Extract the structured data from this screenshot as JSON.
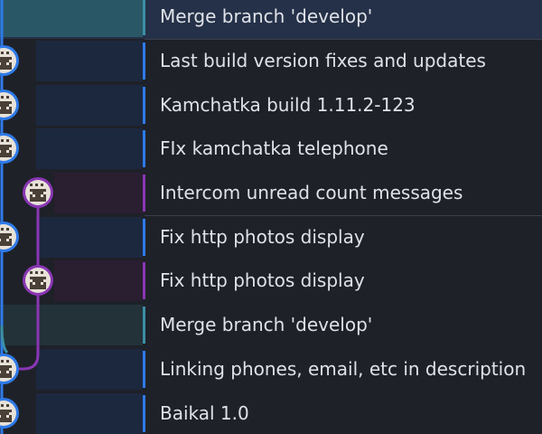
{
  "colors": {
    "background": "#1e2128",
    "selected_row": "#253148",
    "lane_blue": "#2f7ae8",
    "lane_purple": "#8a36b4",
    "lane_teal": "#3b8fa3",
    "text": "#dfe2e8"
  },
  "avatar_icon": "pixel-identicon",
  "commits": [
    {
      "message": "Merge branch 'develop'",
      "lane": "teal",
      "type": "merge",
      "selected": true
    },
    {
      "message": "Last build version fixes and updates",
      "lane": "blue",
      "type": "commit"
    },
    {
      "message": "Kamchatka build 1.11.2-123",
      "lane": "blue",
      "type": "commit"
    },
    {
      "message": "FIx kamchatka telephone",
      "lane": "blue",
      "type": "commit"
    },
    {
      "message": "Intercom unread count messages",
      "lane": "purple",
      "type": "commit"
    },
    {
      "message": "Fix http photos display",
      "lane": "blue",
      "type": "commit"
    },
    {
      "message": "Fix http photos display",
      "lane": "purple",
      "type": "commit"
    },
    {
      "message": "Merge branch 'develop'",
      "lane": "teal",
      "type": "merge"
    },
    {
      "message": "Linking phones, email, etc in description",
      "lane": "blue",
      "type": "commit"
    },
    {
      "message": "Baikal 1.0",
      "lane": "blue",
      "type": "commit"
    }
  ]
}
